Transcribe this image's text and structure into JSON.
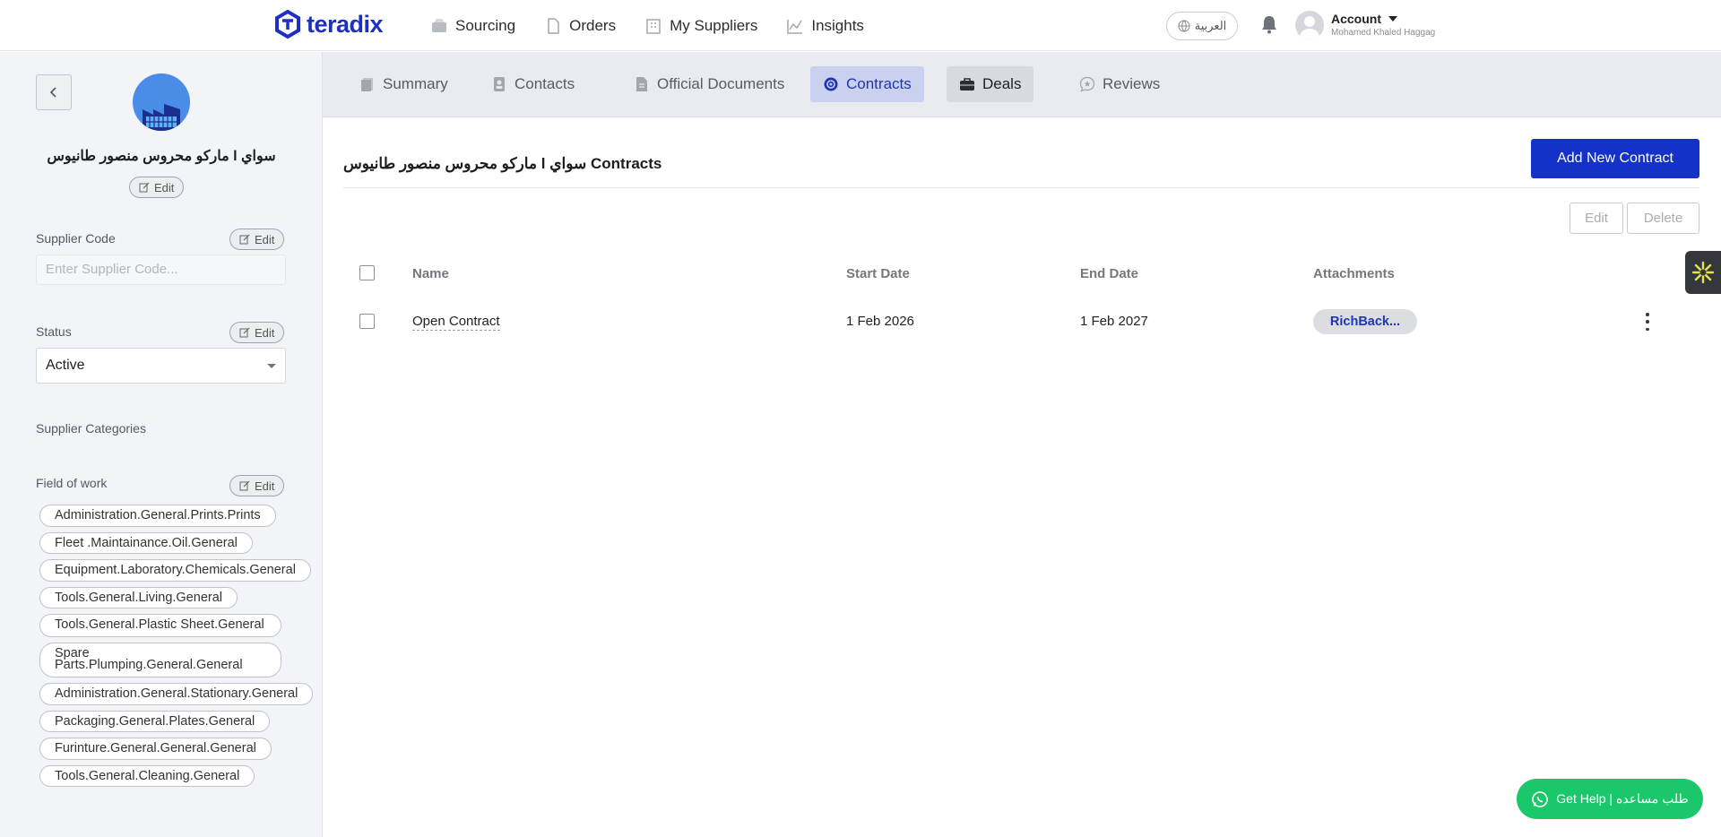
{
  "brand": {
    "name": "teradix",
    "color": "#1d2fc5"
  },
  "nav": {
    "items": [
      {
        "label": "Sourcing",
        "icon": "box-icon"
      },
      {
        "label": "Orders",
        "icon": "document-icon"
      },
      {
        "label": "My Suppliers",
        "icon": "building-icon"
      },
      {
        "label": "Insights",
        "icon": "chart-line-icon"
      }
    ],
    "language": "العربية",
    "account_label": "Account",
    "account_user": "Mohamed Khaled Haggag"
  },
  "sidebar": {
    "supplier_name": "سواي l ماركو محروس منصور طانيوس",
    "edit_label": "Edit",
    "supplier_code_label": "Supplier Code",
    "supplier_code_placeholder": "Enter Supplier Code...",
    "status_label": "Status",
    "status_value": "Active",
    "categories_label": "Supplier Categories",
    "field_of_work_label": "Field of work",
    "field_of_work": [
      "Administration.General.Prints.Prints",
      "Fleet .Maintainance.Oil.General",
      "Equipment.Laboratory.Chemicals.General",
      "Tools.General.Living.General",
      "Tools.General.Plastic Sheet.General",
      "Spare Parts.Plumping.General.General",
      "Administration.General.Stationary.General",
      "Packaging.General.Plates.General",
      "Furinture.General.General.General",
      "Tools.General.Cleaning.General"
    ]
  },
  "tabs": [
    {
      "label": "Summary",
      "icon": "summary-icon"
    },
    {
      "label": "Contacts",
      "icon": "contact-icon"
    },
    {
      "label": "Official Documents",
      "icon": "document-icon"
    },
    {
      "label": "Contracts",
      "icon": "contract-badge-icon"
    },
    {
      "label": "Deals",
      "icon": "briefcase-icon"
    },
    {
      "label": "Reviews",
      "icon": "review-icon"
    }
  ],
  "main": {
    "title_supplier": "سواي l ماركو محروس منصور طانيوس",
    "title_suffix": "Contracts",
    "add_button": "Add New Contract",
    "edit_button": "Edit",
    "delete_button": "Delete",
    "columns": [
      "Name",
      "Start Date",
      "End Date",
      "Attachments"
    ],
    "rows": [
      {
        "name": "Open Contract",
        "start": "1 Feb 2026",
        "end": "1 Feb 2027",
        "attachment": "RichBack..."
      }
    ]
  },
  "help_button": "Get Help | طلب مساعده",
  "colors": {
    "primary": "#1432c8",
    "active_tab_bg": "#c9d1ef",
    "help_green": "#1bc76b"
  }
}
